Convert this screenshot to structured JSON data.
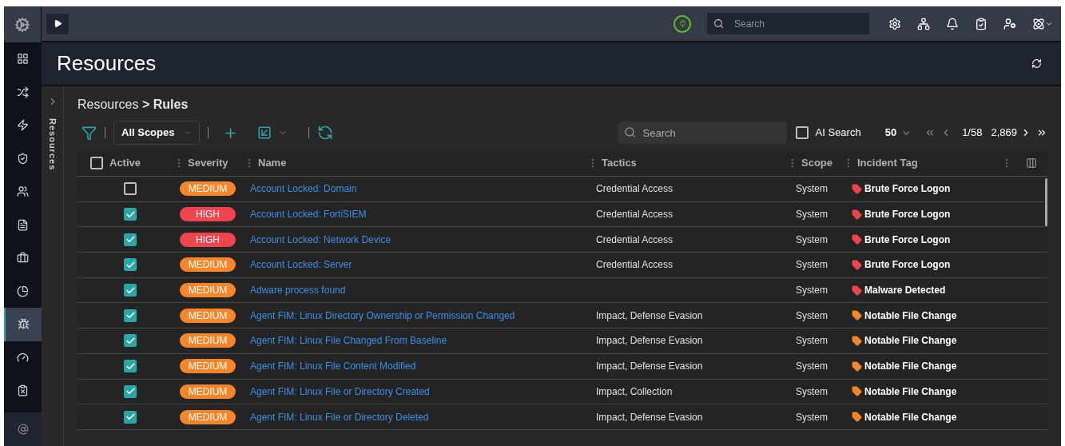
{
  "top_bar": {
    "search": {
      "placeholder": "Search"
    }
  },
  "sidebar": {
    "items": [
      {
        "selected": false
      },
      {
        "selected": false
      },
      {
        "selected": false
      },
      {
        "selected": false
      },
      {
        "selected": false
      },
      {
        "selected": false
      },
      {
        "selected": false
      },
      {
        "selected": false
      },
      {
        "selected": true
      },
      {
        "selected": false
      },
      {
        "selected": false
      }
    ]
  },
  "page": {
    "title": "Resources"
  },
  "panel": {
    "label": "Resources"
  },
  "breadcrumb": "Resources **> Rules**",
  "toolbar": {
    "scope": "All Scopes",
    "search": {
      "placeholder": "Search"
    },
    "ai_search": {
      "label": "AI Search",
      "checked": false
    },
    "page_size": "50",
    "page": "1/58",
    "total": "2,869"
  },
  "table": {
    "select_all": {
      "checked": false
    },
    "columns": [
      "Active",
      "Severity",
      "Name",
      "Tactics",
      "Scope",
      "Incident Tag"
    ],
    "rows": [
      {
        "active": false,
        "severity": {
          "label": "MEDIUM",
          "color": "#f7862a"
        },
        "name": "Account Locked: Domain",
        "tactics": "Credential Access",
        "scope": "System",
        "tag": {
          "label": "Brute Force Logon",
          "color": "#f0444e"
        }
      },
      {
        "active": true,
        "severity": {
          "label": "HIGH",
          "color": "#f0444e"
        },
        "name": "Account Locked: FortiSIEM",
        "tactics": "Credential Access",
        "scope": "System",
        "tag": {
          "label": "Brute Force Logon",
          "color": "#f0444e"
        }
      },
      {
        "active": true,
        "severity": {
          "label": "HIGH",
          "color": "#f0444e"
        },
        "name": "Account Locked: Network Device",
        "tactics": "Credential Access",
        "scope": "System",
        "tag": {
          "label": "Brute Force Logon",
          "color": "#f0444e"
        }
      },
      {
        "active": true,
        "severity": {
          "label": "MEDIUM",
          "color": "#f7862a"
        },
        "name": "Account Locked: Server",
        "tactics": "Credential Access",
        "scope": "System",
        "tag": {
          "label": "Brute Force Logon",
          "color": "#f0444e"
        }
      },
      {
        "active": true,
        "severity": {
          "label": "MEDIUM",
          "color": "#f7862a"
        },
        "name": "Adware process found",
        "scope": "System",
        "tag": {
          "label": "Malware Detected",
          "color": "#f0444e"
        }
      },
      {
        "active": true,
        "severity": {
          "label": "MEDIUM",
          "color": "#f7862a"
        },
        "name": "Agent FIM: Linux Directory Ownership or Permission Changed",
        "tactics": "Impact, Defense Evasion",
        "scope": "System",
        "tag": {
          "label": "Notable File Change",
          "color": "#f7862a"
        }
      },
      {
        "active": true,
        "severity": {
          "label": "MEDIUM",
          "color": "#f7862a"
        },
        "name": "Agent FIM: Linux File Changed From Baseline",
        "tactics": "Impact, Defense Evasion",
        "scope": "System",
        "tag": {
          "label": "Notable File Change",
          "color": "#f7862a"
        }
      },
      {
        "active": true,
        "severity": {
          "label": "MEDIUM",
          "color": "#f7862a"
        },
        "name": "Agent FIM: Linux File Content Modified",
        "tactics": "Impact, Defense Evasion",
        "scope": "System",
        "tag": {
          "label": "Notable File Change",
          "color": "#f7862a"
        }
      },
      {
        "active": true,
        "severity": {
          "label": "MEDIUM",
          "color": "#f7862a"
        },
        "name": "Agent FIM: Linux File or Directory Created",
        "tactics": "Impact, Collection",
        "scope": "System",
        "tag": {
          "label": "Notable File Change",
          "color": "#f7862a"
        }
      },
      {
        "active": true,
        "severity": {
          "label": "MEDIUM",
          "color": "#f7862a"
        },
        "name": "Agent FIM: Linux File or Directory Deleted",
        "tactics": "Impact, Defense Evasion",
        "scope": "System",
        "tag": {
          "label": "Notable File Change",
          "color": "#f7862a"
        }
      }
    ]
  }
}
